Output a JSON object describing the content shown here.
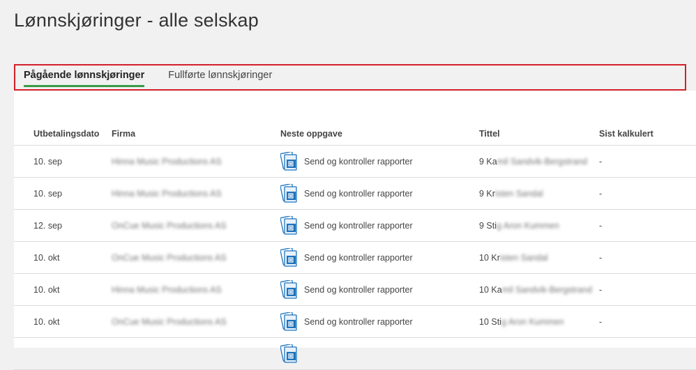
{
  "page": {
    "title": "Lønnskjøringer - alle selskap"
  },
  "tabs": [
    {
      "label": "Pågående lønnskjøringer",
      "active": true
    },
    {
      "label": "Fullførte lønnskjøringer",
      "active": false
    }
  ],
  "table": {
    "columns": [
      "Utbetalingsdato",
      "Firma",
      "Neste oppgave",
      "Tittel",
      "Sist kalkulert"
    ],
    "rows": [
      {
        "date": "10. sep",
        "firm": "Hinna Music Productions AS",
        "task": "Send og kontroller rapporter",
        "title_prefix": "9 Ka",
        "title_rest": "mil Sandvik-Bergstrand",
        "calc": "-"
      },
      {
        "date": "10. sep",
        "firm": "Hinna Music Productions AS",
        "task": "Send og kontroller rapporter",
        "title_prefix": "9 Kr",
        "title_rest": "isten Sandal",
        "calc": "-"
      },
      {
        "date": "12. sep",
        "firm": "OnCue Music Productions AS",
        "task": "Send og kontroller rapporter",
        "title_prefix": "9 Sti",
        "title_rest": "g Aron Kummen",
        "calc": "-"
      },
      {
        "date": "10. okt",
        "firm": "OnCue Music Productions AS",
        "task": "Send og kontroller rapporter",
        "title_prefix": "10 Kr",
        "title_rest": "isten Sandal",
        "calc": "-"
      },
      {
        "date": "10. okt",
        "firm": "Hinna Music Productions AS",
        "task": "Send og kontroller rapporter",
        "title_prefix": "10 Ka",
        "title_rest": "mil Sandvik-Bergstrand",
        "calc": "-"
      },
      {
        "date": "10. okt",
        "firm": "OnCue Music Productions AS",
        "task": "Send og kontroller rapporter",
        "title_prefix": "10 Sti",
        "title_rest": "g Aron Kummen",
        "calc": "-"
      },
      {
        "date": "",
        "firm": "",
        "task": "",
        "title_prefix": "",
        "title_rest": "",
        "calc": ""
      }
    ]
  },
  "icons": {
    "task": "report-send-icon"
  },
  "colors": {
    "active_tab_underline": "#3b9a46",
    "highlight_border": "#d2202a",
    "icon_blue": "#1e73be"
  }
}
